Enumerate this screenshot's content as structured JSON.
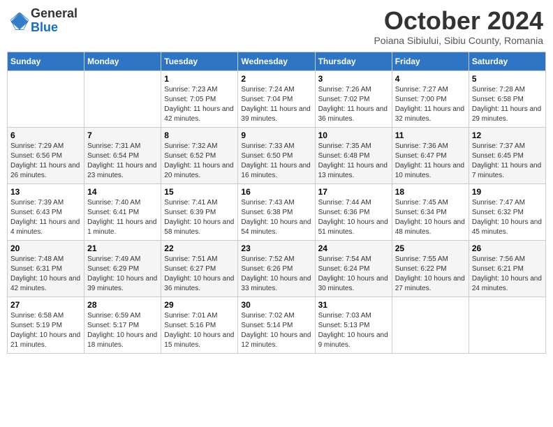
{
  "header": {
    "logo_text_general": "General",
    "logo_text_blue": "Blue",
    "month_title": "October 2024",
    "location": "Poiana Sibiului, Sibiu County, Romania"
  },
  "days_of_week": [
    "Sunday",
    "Monday",
    "Tuesday",
    "Wednesday",
    "Thursday",
    "Friday",
    "Saturday"
  ],
  "weeks": [
    [
      {
        "day": "",
        "info": ""
      },
      {
        "day": "",
        "info": ""
      },
      {
        "day": "1",
        "info": "Sunrise: 7:23 AM\nSunset: 7:05 PM\nDaylight: 11 hours and 42 minutes."
      },
      {
        "day": "2",
        "info": "Sunrise: 7:24 AM\nSunset: 7:04 PM\nDaylight: 11 hours and 39 minutes."
      },
      {
        "day": "3",
        "info": "Sunrise: 7:26 AM\nSunset: 7:02 PM\nDaylight: 11 hours and 36 minutes."
      },
      {
        "day": "4",
        "info": "Sunrise: 7:27 AM\nSunset: 7:00 PM\nDaylight: 11 hours and 32 minutes."
      },
      {
        "day": "5",
        "info": "Sunrise: 7:28 AM\nSunset: 6:58 PM\nDaylight: 11 hours and 29 minutes."
      }
    ],
    [
      {
        "day": "6",
        "info": "Sunrise: 7:29 AM\nSunset: 6:56 PM\nDaylight: 11 hours and 26 minutes."
      },
      {
        "day": "7",
        "info": "Sunrise: 7:31 AM\nSunset: 6:54 PM\nDaylight: 11 hours and 23 minutes."
      },
      {
        "day": "8",
        "info": "Sunrise: 7:32 AM\nSunset: 6:52 PM\nDaylight: 11 hours and 20 minutes."
      },
      {
        "day": "9",
        "info": "Sunrise: 7:33 AM\nSunset: 6:50 PM\nDaylight: 11 hours and 16 minutes."
      },
      {
        "day": "10",
        "info": "Sunrise: 7:35 AM\nSunset: 6:48 PM\nDaylight: 11 hours and 13 minutes."
      },
      {
        "day": "11",
        "info": "Sunrise: 7:36 AM\nSunset: 6:47 PM\nDaylight: 11 hours and 10 minutes."
      },
      {
        "day": "12",
        "info": "Sunrise: 7:37 AM\nSunset: 6:45 PM\nDaylight: 11 hours and 7 minutes."
      }
    ],
    [
      {
        "day": "13",
        "info": "Sunrise: 7:39 AM\nSunset: 6:43 PM\nDaylight: 11 hours and 4 minutes."
      },
      {
        "day": "14",
        "info": "Sunrise: 7:40 AM\nSunset: 6:41 PM\nDaylight: 11 hours and 1 minute."
      },
      {
        "day": "15",
        "info": "Sunrise: 7:41 AM\nSunset: 6:39 PM\nDaylight: 10 hours and 58 minutes."
      },
      {
        "day": "16",
        "info": "Sunrise: 7:43 AM\nSunset: 6:38 PM\nDaylight: 10 hours and 54 minutes."
      },
      {
        "day": "17",
        "info": "Sunrise: 7:44 AM\nSunset: 6:36 PM\nDaylight: 10 hours and 51 minutes."
      },
      {
        "day": "18",
        "info": "Sunrise: 7:45 AM\nSunset: 6:34 PM\nDaylight: 10 hours and 48 minutes."
      },
      {
        "day": "19",
        "info": "Sunrise: 7:47 AM\nSunset: 6:32 PM\nDaylight: 10 hours and 45 minutes."
      }
    ],
    [
      {
        "day": "20",
        "info": "Sunrise: 7:48 AM\nSunset: 6:31 PM\nDaylight: 10 hours and 42 minutes."
      },
      {
        "day": "21",
        "info": "Sunrise: 7:49 AM\nSunset: 6:29 PM\nDaylight: 10 hours and 39 minutes."
      },
      {
        "day": "22",
        "info": "Sunrise: 7:51 AM\nSunset: 6:27 PM\nDaylight: 10 hours and 36 minutes."
      },
      {
        "day": "23",
        "info": "Sunrise: 7:52 AM\nSunset: 6:26 PM\nDaylight: 10 hours and 33 minutes."
      },
      {
        "day": "24",
        "info": "Sunrise: 7:54 AM\nSunset: 6:24 PM\nDaylight: 10 hours and 30 minutes."
      },
      {
        "day": "25",
        "info": "Sunrise: 7:55 AM\nSunset: 6:22 PM\nDaylight: 10 hours and 27 minutes."
      },
      {
        "day": "26",
        "info": "Sunrise: 7:56 AM\nSunset: 6:21 PM\nDaylight: 10 hours and 24 minutes."
      }
    ],
    [
      {
        "day": "27",
        "info": "Sunrise: 6:58 AM\nSunset: 5:19 PM\nDaylight: 10 hours and 21 minutes."
      },
      {
        "day": "28",
        "info": "Sunrise: 6:59 AM\nSunset: 5:17 PM\nDaylight: 10 hours and 18 minutes."
      },
      {
        "day": "29",
        "info": "Sunrise: 7:01 AM\nSunset: 5:16 PM\nDaylight: 10 hours and 15 minutes."
      },
      {
        "day": "30",
        "info": "Sunrise: 7:02 AM\nSunset: 5:14 PM\nDaylight: 10 hours and 12 minutes."
      },
      {
        "day": "31",
        "info": "Sunrise: 7:03 AM\nSunset: 5:13 PM\nDaylight: 10 hours and 9 minutes."
      },
      {
        "day": "",
        "info": ""
      },
      {
        "day": "",
        "info": ""
      }
    ]
  ]
}
